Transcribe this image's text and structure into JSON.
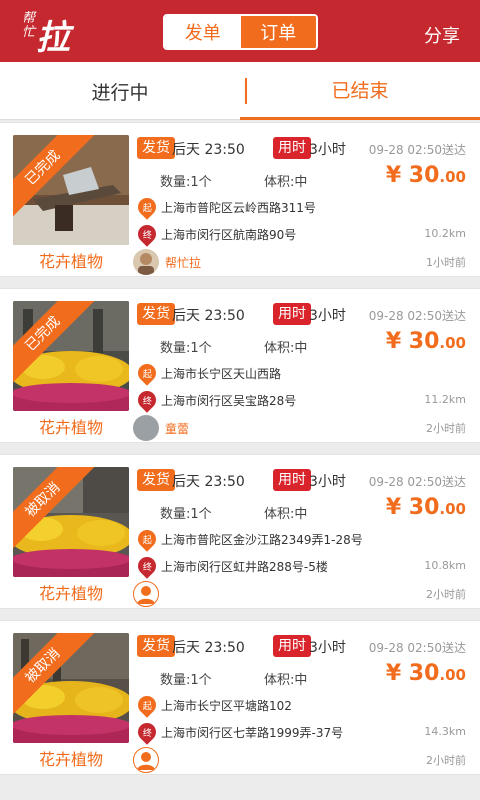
{
  "header": {
    "logo_text": "拉",
    "logo_small": "帮忙",
    "toggle": [
      "发单",
      "订单"
    ],
    "toggle_selected": "发单",
    "share": "分享"
  },
  "tabs": {
    "ongoing": "进行中",
    "finished": "已结束",
    "selected": "finished"
  },
  "colors": {
    "brand_red": "#c5282e",
    "accent_orange": "#f26c1d"
  },
  "orders": [
    {
      "status": "已完成",
      "category": "花卉植物",
      "send_label": "发货",
      "send_time": "后天 23:50",
      "use_label": "用时",
      "duration": "3小时",
      "deliver_time": "09-28 02:50送达",
      "qty": "数量:1个",
      "volume": "体积:中",
      "price_int": "¥ 30",
      "price_dec": ".00",
      "from_marker": "起",
      "to_marker": "终",
      "from": "上海市普陀区云岭西路311号",
      "to": "上海市闵行区航南路90号",
      "distance": "10.2km",
      "user": "帮忙拉",
      "ago": "1小时前",
      "photo": "boat",
      "avatar": "photo"
    },
    {
      "status": "已完成",
      "category": "花卉植物",
      "send_label": "发货",
      "send_time": "后天 23:50",
      "use_label": "用时",
      "duration": "3小时",
      "deliver_time": "09-28 02:50送达",
      "qty": "数量:1个",
      "volume": "体积:中",
      "price_int": "¥ 30",
      "price_dec": ".00",
      "from_marker": "起",
      "to_marker": "终",
      "from": "上海市长宁区天山西路",
      "to": "上海市闵行区吴宝路28号",
      "distance": "11.2km",
      "user": "童蕾",
      "ago": "2小时前",
      "photo": "flowers",
      "avatar": "gray"
    },
    {
      "status": "被取消",
      "category": "花卉植物",
      "send_label": "发货",
      "send_time": "后天 23:50",
      "use_label": "用时",
      "duration": "3小时",
      "deliver_time": "09-28 02:50送达",
      "qty": "数量:1个",
      "volume": "体积:中",
      "price_int": "¥ 30",
      "price_dec": ".00",
      "from_marker": "起",
      "to_marker": "终",
      "from": "上海市普陀区金沙江路2349弄1-28号",
      "to": "上海市闵行区虹井路288号-5楼",
      "distance": "10.8km",
      "user": "",
      "ago": "2小时前",
      "photo": "flowers",
      "avatar": "default"
    },
    {
      "status": "被取消",
      "category": "花卉植物",
      "send_label": "发货",
      "send_time": "后天 23:50",
      "use_label": "用时",
      "duration": "3小时",
      "deliver_time": "09-28 02:50送达",
      "qty": "数量:1个",
      "volume": "体积:中",
      "price_int": "¥ 30",
      "price_dec": ".00",
      "from_marker": "起",
      "to_marker": "终",
      "from": "上海市长宁区平塘路102",
      "to": "上海市闵行区七莘路1999弄-37号",
      "distance": "14.3km",
      "user": "",
      "ago": "2小时前",
      "photo": "flowers",
      "avatar": "default"
    }
  ]
}
